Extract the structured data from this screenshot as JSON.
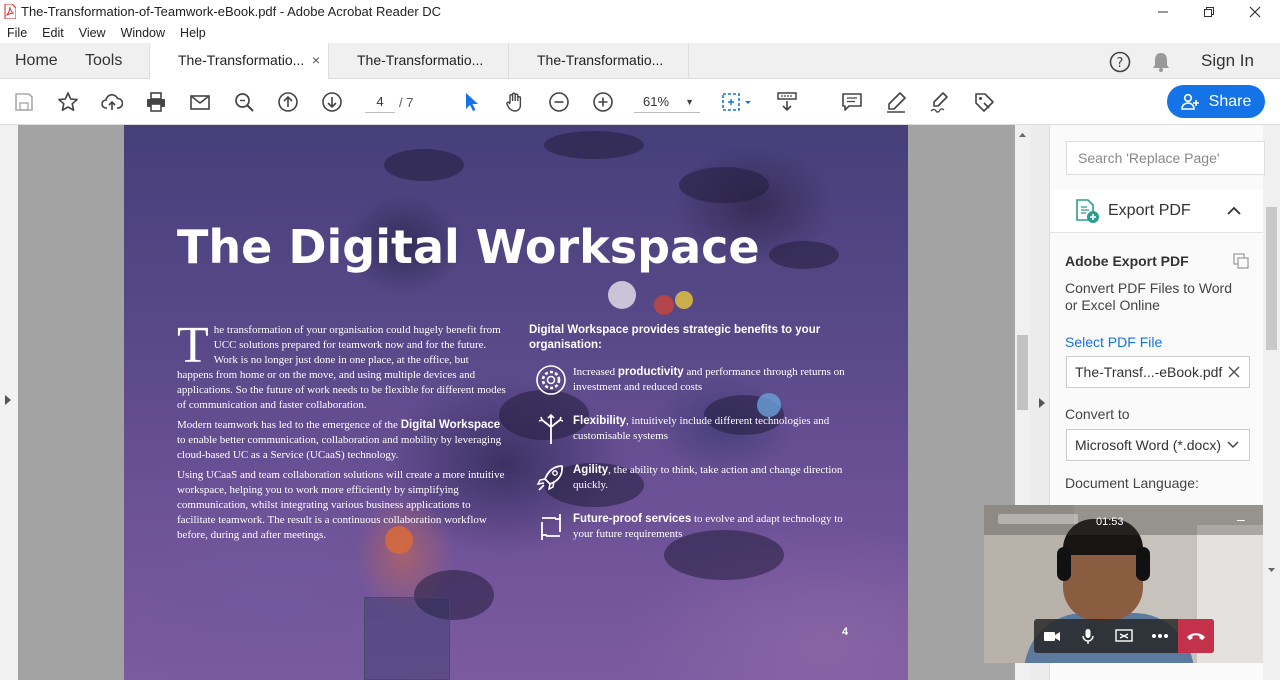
{
  "window": {
    "title": "The-Transformation-of-Teamwork-eBook.pdf - Adobe Acrobat Reader DC"
  },
  "menu": [
    "File",
    "Edit",
    "View",
    "Window",
    "Help"
  ],
  "nav": {
    "home": "Home",
    "tools": "Tools"
  },
  "tabs": [
    {
      "label": "The-Transformatio...",
      "close": "×",
      "active": true
    },
    {
      "label": "The-Transformatio...",
      "active": false
    },
    {
      "label": "The-Transformatio...",
      "active": false
    }
  ],
  "header_right": {
    "sign_in": "Sign In"
  },
  "toolbar": {
    "page_current": "4",
    "page_total": "/ 7",
    "zoom": "61%",
    "share_label": "Share"
  },
  "document": {
    "title": "The Digital Workspace",
    "dropcap": "T",
    "para1": "he transformation of your organisation could hugely benefit from UCC solutions prepared for teamwork now and for the future. Work is no longer just done in one place, at the office, but happens from home or on the move, and using multiple devices and applications. So the future of work needs to be flexible for different modes of communication and faster collaboration.",
    "para2_pre": "Modern teamwork has led to the emergence of the ",
    "para2_bold": "Digital Workspace",
    "para2_post": " to enable better communication, collaboration and mobility by leveraging cloud-based UC as a Service (UCaaS) technology.",
    "para3": "Using UCaaS and team collaboration solutions will create a more intuitive workspace, helping you to work more efficiently by simplifying communication, whilst integrating various business applications to facilitate teamwork. The result is a continuous collaboration workflow before, during and after meetings.",
    "benefits_heading": "Digital Workspace provides strategic benefits to your organisation:",
    "benefits": [
      {
        "icon": "settings-cog-icon",
        "pre": "Increased ",
        "bold": "productivity",
        "post": " and performance through returns on investment and reduced costs"
      },
      {
        "icon": "branching-arrows-icon",
        "pre": "",
        "bold": "Flexibility",
        "post": ", intuitively include different technologies and customisable systems"
      },
      {
        "icon": "rocket-icon",
        "pre": "",
        "bold": "Agility",
        "post": ", the ability to think, take action and change direction quickly."
      },
      {
        "icon": "refresh-cycle-icon",
        "pre": "",
        "bold": "Future-proof services",
        "post": " to evolve and adapt technology to your future requirements"
      }
    ],
    "page_number": "4"
  },
  "right_panel": {
    "search_placeholder": "Search 'Replace Page'",
    "export_title": "Export PDF",
    "adobe_export_title": "Adobe Export PDF",
    "description": "Convert PDF Files to Word or Excel Online",
    "select_pdf_label": "Select PDF File",
    "selected_file": "The-Transf...-eBook.pdf",
    "convert_to_label": "Convert to",
    "convert_to_value": "Microsoft Word (*.docx)",
    "document_language_label": "Document Language:"
  },
  "video_call": {
    "timer": "01:53"
  },
  "colors": {
    "accent": "#1473e6",
    "link": "#1473e6",
    "hangup": "#c4314b"
  }
}
